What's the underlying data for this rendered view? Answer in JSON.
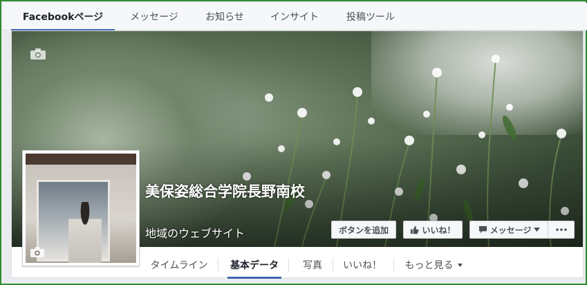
{
  "admin_tabs": [
    {
      "label": "Facebookページ",
      "active": true
    },
    {
      "label": "メッセージ",
      "active": false
    },
    {
      "label": "お知らせ",
      "active": false
    },
    {
      "label": "インサイト",
      "active": false
    },
    {
      "label": "投稿ツール",
      "active": false
    }
  ],
  "page": {
    "name": "美保姿総合学院長野南校",
    "category": "地域のウェブサイト"
  },
  "actions": {
    "add_button": "ボタンを追加",
    "like": "いいね！",
    "message": "メッセージ"
  },
  "nav_tabs": [
    {
      "label": "タイムライン",
      "active": false
    },
    {
      "label": "基本データ",
      "active": true
    },
    {
      "label": "写真",
      "active": false
    },
    {
      "label": "いいね！",
      "active": false
    },
    {
      "label": "もっと見る",
      "active": false
    }
  ],
  "icons": {
    "cover_camera": "camera-icon",
    "profile_camera": "camera-icon",
    "like": "thumbs-up-icon",
    "message": "speech-bubble-icon",
    "more": "ellipsis-icon",
    "dropdown": "caret-down-icon"
  },
  "colors": {
    "accent": "#4267b2",
    "frame_border": "#2e8b2e"
  }
}
